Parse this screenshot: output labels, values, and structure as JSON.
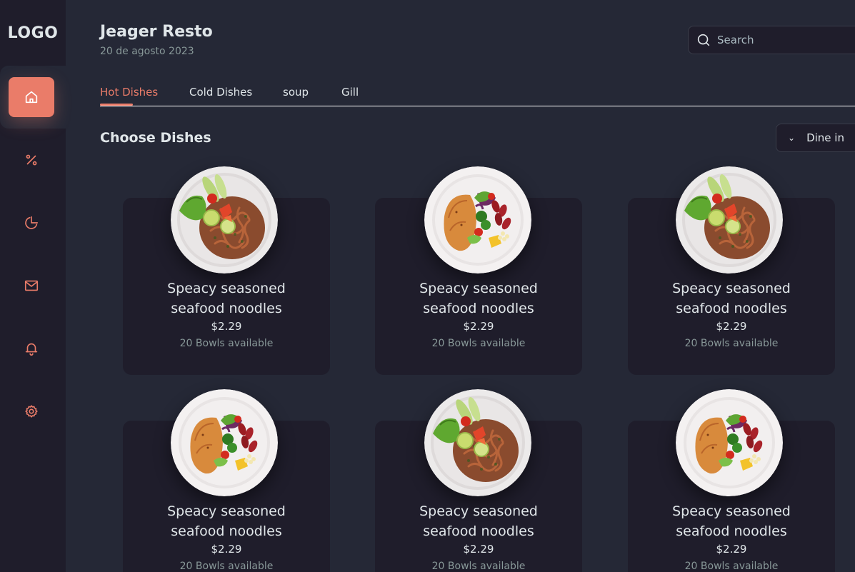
{
  "sidebar": {
    "logo": "LOGO",
    "items": [
      {
        "icon": "home-icon",
        "active": true
      },
      {
        "icon": "discount-icon",
        "active": false
      },
      {
        "icon": "chart-icon",
        "active": false
      },
      {
        "icon": "mail-icon",
        "active": false
      },
      {
        "icon": "bell-icon",
        "active": false
      },
      {
        "icon": "settings-icon",
        "active": false
      }
    ]
  },
  "header": {
    "title": "Jeager Resto",
    "date": "20 de agosto 2023",
    "search_placeholder": "Search"
  },
  "tabs": [
    "Hot Dishes",
    "Cold Dishes",
    "soup",
    "Gill"
  ],
  "section": {
    "title": "Choose Dishes",
    "order_type": "Dine in"
  },
  "dishes": [
    {
      "name_line1": "Speacy seasoned",
      "name_line2": "seafood noodles",
      "price": "$2.29",
      "stock": "20 Bowls available",
      "image": "noodles"
    },
    {
      "name_line1": "Speacy seasoned",
      "name_line2": "seafood noodles",
      "price": "$2.29",
      "stock": "20 Bowls available",
      "image": "chicken"
    },
    {
      "name_line1": "Speacy seasoned",
      "name_line2": "seafood noodles",
      "price": "$2.29",
      "stock": "20 Bowls available",
      "image": "noodles"
    },
    {
      "name_line1": "Speacy seasoned",
      "name_line2": "seafood noodles",
      "price": "$2.29",
      "stock": "20 Bowls available",
      "image": "chicken"
    },
    {
      "name_line1": "Speacy seasoned",
      "name_line2": "seafood noodles",
      "price": "$2.29",
      "stock": "20 Bowls available",
      "image": "noodles"
    },
    {
      "name_line1": "Speacy seasoned",
      "name_line2": "seafood noodles",
      "price": "$2.29",
      "stock": "20 Bowls available",
      "image": "chicken"
    }
  ],
  "colors": {
    "accent": "#ea7c69",
    "background": "#252836",
    "surface": "#1f1d2b",
    "text_primary": "#e0e6e9",
    "text_secondary": "#889898"
  }
}
